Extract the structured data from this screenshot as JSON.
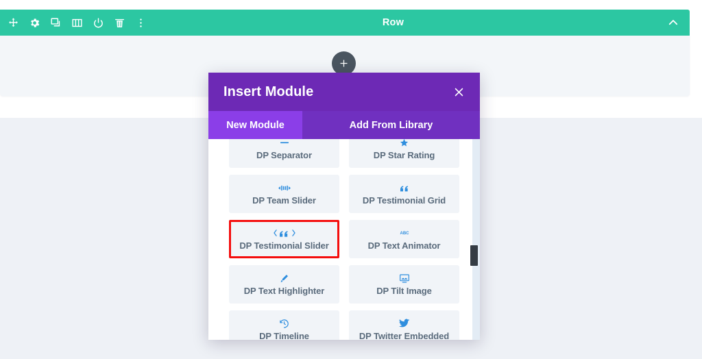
{
  "row_toolbar": {
    "title": "Row",
    "background_color": "#2cc7a2",
    "icons": [
      {
        "name": "move-icon",
        "label": "Move"
      },
      {
        "name": "gear-icon",
        "label": "Settings"
      },
      {
        "name": "duplicate-icon",
        "label": "Duplicate"
      },
      {
        "name": "columns-icon",
        "label": "Columns"
      },
      {
        "name": "power-icon",
        "label": "Disable"
      },
      {
        "name": "trash-icon",
        "label": "Delete"
      },
      {
        "name": "more-vertical-icon",
        "label": "More Options"
      }
    ],
    "collapse_icon": "chevron-up-icon"
  },
  "add_button": {
    "icon": "plus-icon",
    "background_color": "#4a5560"
  },
  "modal": {
    "title": "Insert Module",
    "close_icon": "close-icon",
    "header_color": "#6d29b5",
    "tabs": [
      {
        "label": "New Module",
        "active": true,
        "color": "#8b3ee8"
      },
      {
        "label": "Add From Library",
        "active": false,
        "color": "#7030c0"
      }
    ],
    "highlight_color": "#f40d0d",
    "icon_color": "#2f8ede",
    "modules": [
      {
        "label": "DP Separator",
        "icon": "minus-icon",
        "glyph": "—",
        "highlighted": false
      },
      {
        "label": "DP Star Rating",
        "icon": "star-icon",
        "glyph": "★",
        "highlighted": false
      },
      {
        "label": "DP Team Slider",
        "icon": "team-slider-icon",
        "glyph": "◀▌▶",
        "highlighted": false
      },
      {
        "label": "DP Testimonial Grid",
        "icon": "quote-icon",
        "glyph": "“",
        "highlighted": false
      },
      {
        "label": "DP Testimonial Slider",
        "icon": "quote-slider-icon",
        "glyph": "‹ “ ›",
        "highlighted": true
      },
      {
        "label": "DP Text Animator",
        "icon": "abc-icon",
        "glyph": "ABC",
        "highlighted": false
      },
      {
        "label": "DP Text Highlighter",
        "icon": "brush-icon",
        "glyph": "✒",
        "highlighted": false
      },
      {
        "label": "DP Tilt Image",
        "icon": "image-icon",
        "glyph": "▣",
        "highlighted": false
      },
      {
        "label": "DP Timeline",
        "icon": "clock-history-icon",
        "glyph": "◴",
        "highlighted": false
      },
      {
        "label": "DP Twitter Embedded",
        "icon": "twitter-icon",
        "glyph": "ᵗ",
        "highlighted": false
      }
    ],
    "scrollbar": {
      "name": "modal-scrollbar"
    }
  }
}
